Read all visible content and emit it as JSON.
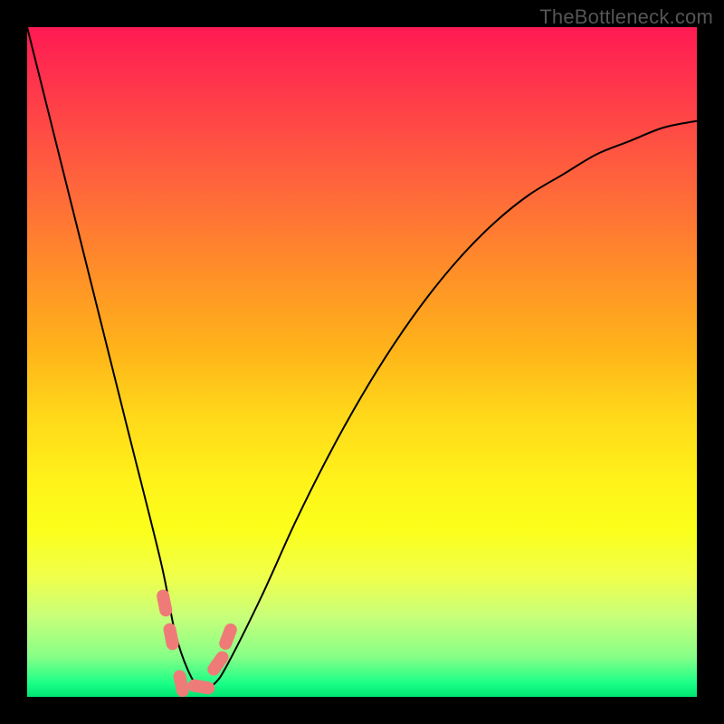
{
  "watermark": "TheBottleneck.com",
  "colors": {
    "frame": "#000000",
    "gradient_top": "#ff1a53",
    "gradient_bottom": "#00e572",
    "curve": "#000000",
    "marker": "#ef7b78"
  },
  "chart_data": {
    "type": "line",
    "title": "",
    "xlabel": "",
    "ylabel": "",
    "xlim": [
      0,
      100
    ],
    "ylim": [
      0,
      100
    ],
    "series": [
      {
        "name": "bottleneck_curve",
        "x": [
          0,
          5,
          10,
          15,
          20,
          22,
          24,
          26,
          28,
          30,
          35,
          40,
          45,
          50,
          55,
          60,
          65,
          70,
          75,
          80,
          85,
          90,
          95,
          100
        ],
        "values": [
          100,
          80,
          60,
          40,
          20,
          10,
          4,
          1,
          2,
          5,
          15,
          26,
          36,
          45,
          53,
          60,
          66,
          71,
          75,
          78,
          81,
          83,
          85,
          86
        ]
      }
    ],
    "markers": [
      {
        "x": 20.5,
        "y": 14
      },
      {
        "x": 21.5,
        "y": 9
      },
      {
        "x": 23.0,
        "y": 2
      },
      {
        "x": 26.0,
        "y": 1.5
      },
      {
        "x": 28.5,
        "y": 5
      },
      {
        "x": 30.0,
        "y": 9
      }
    ]
  }
}
